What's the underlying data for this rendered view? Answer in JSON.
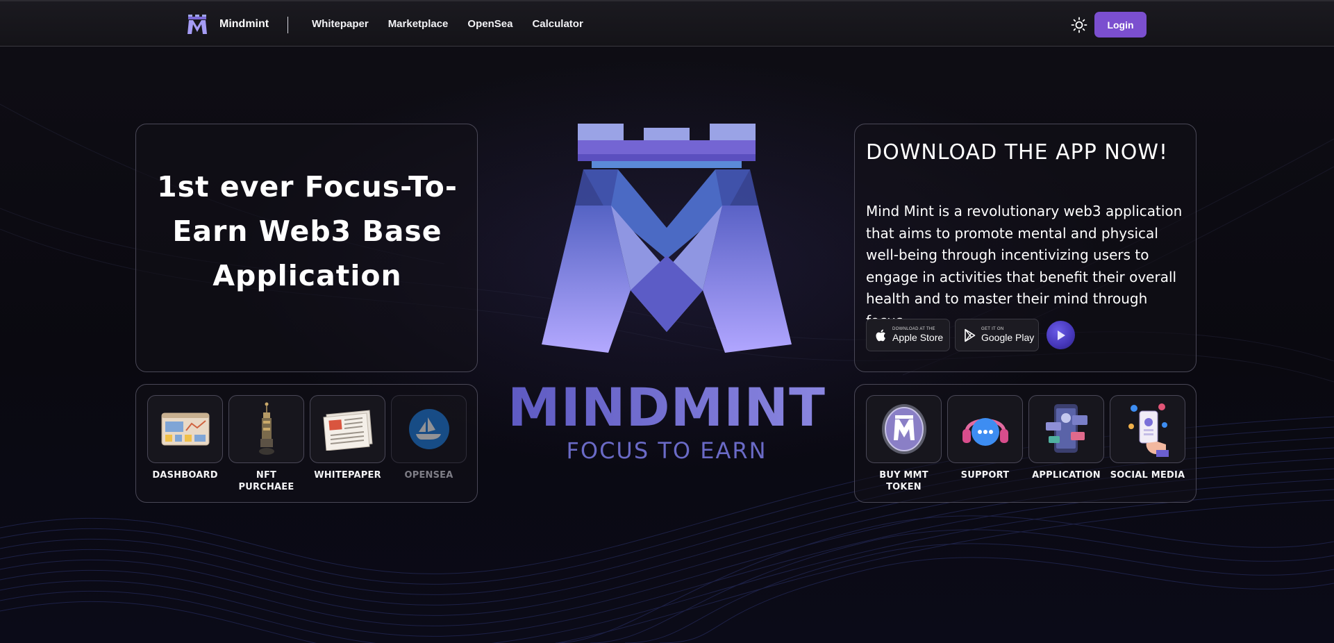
{
  "nav": {
    "brand": "Mindmint",
    "links": [
      "Whitepaper",
      "Marketplace",
      "OpenSea",
      "Calculator"
    ],
    "login_label": "Login",
    "theme_icon": "sun-icon"
  },
  "hero": {
    "title": "1st ever Focus-To-Earn Web3 Base Application"
  },
  "center": {
    "wordmark": "MINDMINT",
    "tagline": "FOCUS TO EARN"
  },
  "app": {
    "title": "DOWNLOAD THE APP NOW!",
    "description": "Mind Mint is a revolutionary web3 application that aims to promote mental and physical well-being through incentivizing users to engage in activities that benefit their overall health and to master their mind through focus.",
    "apple_small": "DOWNLOAD AT THE",
    "apple_big": "Apple Store",
    "google_small": "GET IT ON",
    "google_big": "Google Play"
  },
  "quick_left": [
    {
      "label": "DASHBOARD",
      "icon": "dashboard-icon"
    },
    {
      "label": "NFT PURCHAEE",
      "icon": "nft-tower-icon"
    },
    {
      "label": "WHITEPAPER",
      "icon": "newspaper-icon"
    },
    {
      "label": "OPENSEA",
      "icon": "opensea-icon"
    }
  ],
  "quick_right": [
    {
      "label": "BUY MMT TOKEN",
      "icon": "token-coin-icon"
    },
    {
      "label": "SUPPORT",
      "icon": "headset-icon"
    },
    {
      "label": "APPLICATION",
      "icon": "phone-app-icon"
    },
    {
      "label": "SOCIAL MEDIA",
      "icon": "social-hand-icon"
    }
  ],
  "colors": {
    "accent": "#7b4fcf",
    "logo_light": "#b3a9ff",
    "logo_blue": "#5c6cc8",
    "wordmark": "#6b67c9"
  }
}
